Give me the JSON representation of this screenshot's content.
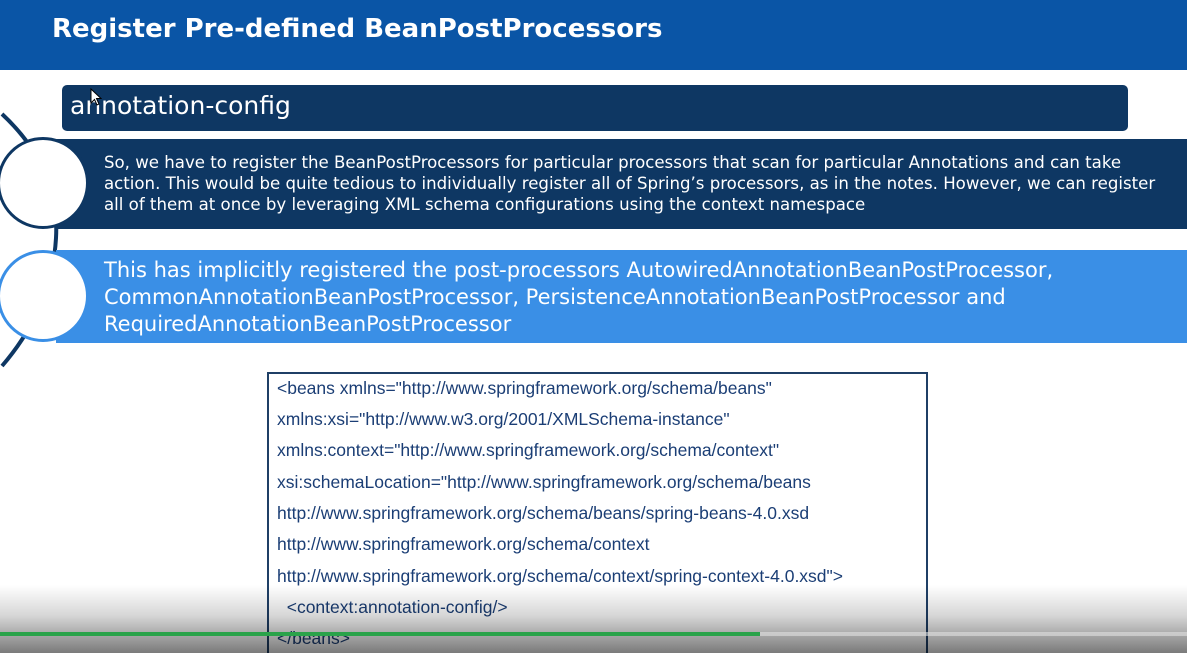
{
  "slide": {
    "title": "Register Pre-defined BeanPostProcessors",
    "section_header": "annotation-config",
    "paragraph_1": "So, we have to register the BeanPostProcessors for particular processors that scan for particular Annotations and can take action. This would be quite tedious to individually register all of Spring’s processors, as in the notes. However, we can register all of them at once by leveraging XML schema configurations using the context namespace",
    "paragraph_2": "This has implicitly registered the post-processors AutowiredAnnotationBeanPostProcessor, CommonAnnotationBeanPostProcessor, PersistenceAnnotationBeanPostProcessor and RequiredAnnotationBeanPostProcessor",
    "code_lines": [
      "<beans xmlns=\"http://www.springframework.org/schema/beans\"",
      "xmlns:xsi=\"http://www.w3.org/2001/XMLSchema-instance\"",
      "xmlns:context=\"http://www.springframework.org/schema/context\"",
      "xsi:schemaLocation=\"http://www.springframework.org/schema/beans",
      "http://www.springframework.org/schema/beans/spring-beans-4.0.xsd",
      "http://www.springframework.org/schema/context",
      "http://www.springframework.org/schema/context/spring-context-4.0.xsd\">",
      "  <context:annotation-config/>",
      "</beans>"
    ]
  },
  "player": {
    "progress_percent": 64
  },
  "colors": {
    "title_bar": "#0a55a6",
    "dark_band": "#0e3763",
    "light_band": "#3a8fe6",
    "code_text": "#1b3e75",
    "progress": "#2aa34a"
  }
}
